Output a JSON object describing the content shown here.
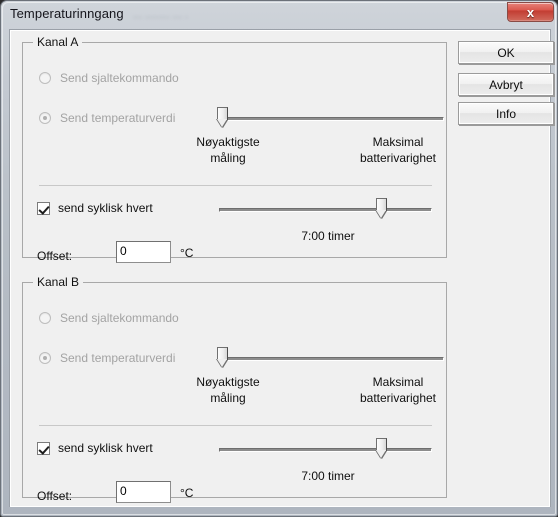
{
  "window": {
    "title": "Temperaturinngang",
    "ghost_title": "...  ........  ...  .",
    "close_label": "x",
    "close_icon": "close-icon"
  },
  "buttons": {
    "ok": "OK",
    "cancel": "Avbryt",
    "info": "Info"
  },
  "channels": [
    {
      "title": "Kanal A",
      "radio_switch": {
        "label": "Send sjaltekommando",
        "checked": false,
        "disabled": true
      },
      "radio_temp": {
        "label": "Send temperaturverdi",
        "checked": true,
        "disabled": true
      },
      "accuracy_slider": {
        "left_label_line1": "Nøyaktigste",
        "left_label_line2": "måling",
        "right_label_line1": "Maksimal",
        "right_label_line2": "batterivarighet",
        "position_percent": 0
      },
      "cyclic": {
        "label": "send syklisk hvert",
        "checked": true
      },
      "interval_slider": {
        "value_label": "7:00 timer",
        "position_percent": 73
      },
      "offset": {
        "label": "Offset:",
        "value": "0",
        "unit": "°C"
      }
    },
    {
      "title": "Kanal B",
      "radio_switch": {
        "label": "Send sjaltekommando",
        "checked": false,
        "disabled": true
      },
      "radio_temp": {
        "label": "Send temperaturverdi",
        "checked": true,
        "disabled": true
      },
      "accuracy_slider": {
        "left_label_line1": "Nøyaktigste",
        "left_label_line2": "måling",
        "right_label_line1": "Maksimal",
        "right_label_line2": "batterivarighet",
        "position_percent": 0
      },
      "cyclic": {
        "label": "send syklisk hvert",
        "checked": true
      },
      "interval_slider": {
        "value_label": "7:00 timer",
        "position_percent": 73
      },
      "offset": {
        "label": "Offset:",
        "value": "0",
        "unit": "°C"
      }
    }
  ],
  "colors": {
    "close_red": "#d9554a",
    "client_bg": "#f0f0f0",
    "group_border": "#a8a8a8",
    "disabled_text": "#a3a3a3"
  }
}
